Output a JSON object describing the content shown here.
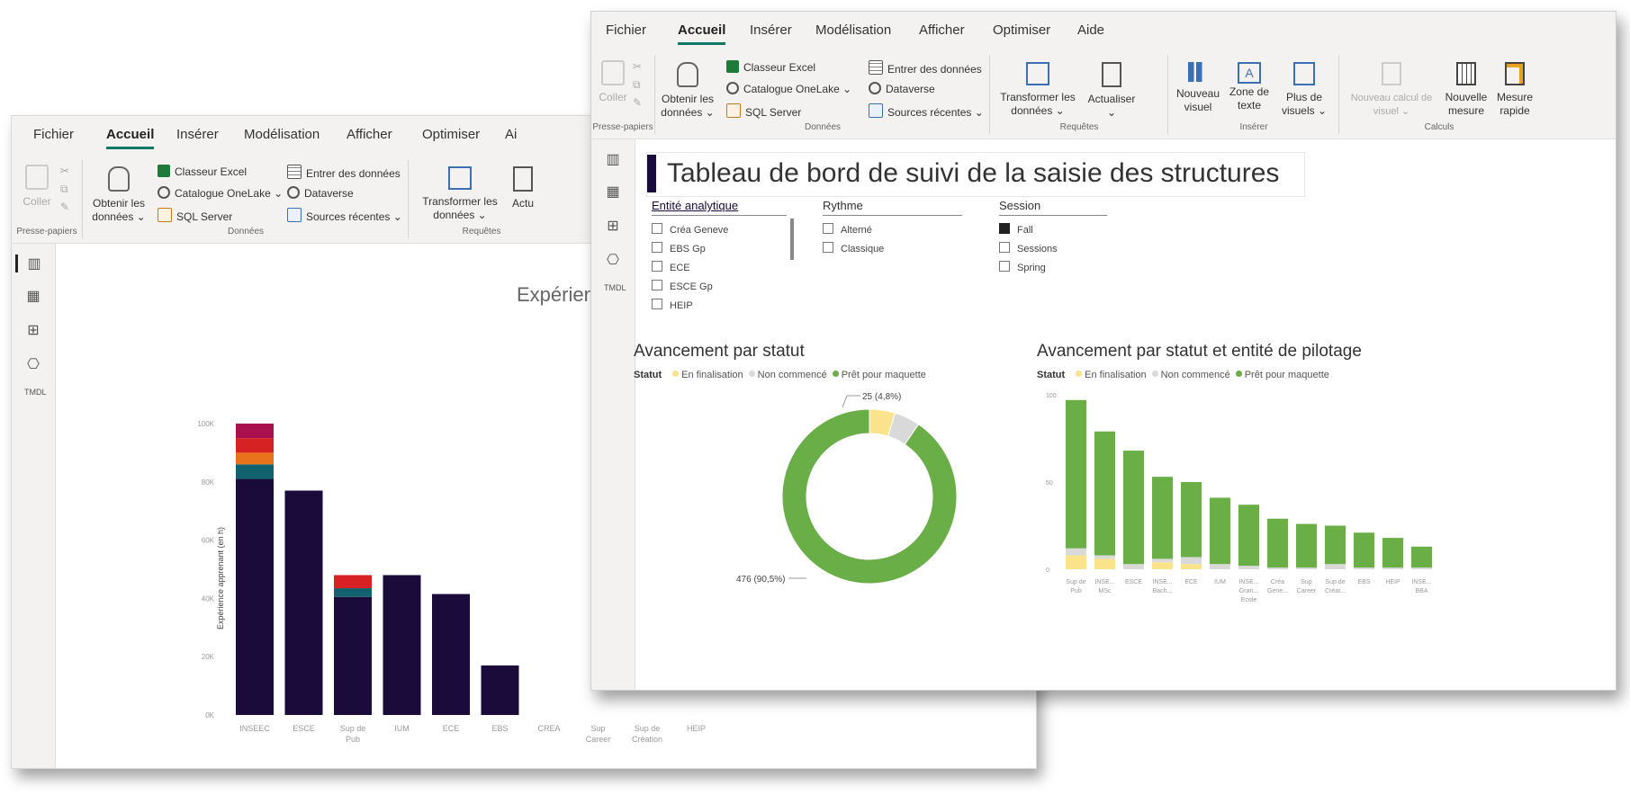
{
  "menu": [
    "Fichier",
    "Accueil",
    "Insérer",
    "Modélisation",
    "Afficher",
    "Optimiser",
    "Aide"
  ],
  "back_menu_last": "Ai",
  "ribbon": {
    "coller": "Coller",
    "presse_papiers": "Presse-papiers",
    "obtenir_l1": "Obtenir les",
    "obtenir_l2": "données ⌄",
    "classeur": "Classeur Excel",
    "onelake": "Catalogue OneLake ⌄",
    "sql": "SQL Server",
    "entrer": "Entrer des données",
    "dataverse": "Dataverse",
    "sources": "Sources récentes ⌄",
    "donnees": "Données",
    "transformer_l1": "Transformer les",
    "transformer_l2": "données ⌄",
    "actualiser": "Actualiser",
    "actualiser_back": "Actu",
    "requetes": "Requêtes",
    "nouveau_l1": "Nouveau",
    "nouveau_l2": "visuel",
    "zone_l1": "Zone de",
    "zone_l2": "texte",
    "plus_l1": "Plus de",
    "plus_l2": "visuels ⌄",
    "inserer": "Insérer",
    "nouveau_calc_l1": "Nouveau calcul de",
    "nouveau_calc_l2": "visuel ⌄",
    "nouvelle_l1": "Nouvelle",
    "nouvelle_l2": "mesure",
    "mesure_l1": "Mesure",
    "mesure_l2": "rapide",
    "calculs": "Calculs"
  },
  "icons": [
    "report-view-icon",
    "table-view-icon",
    "model-view-icon",
    "dax-query-icon",
    "tmdl-view-icon"
  ],
  "tmdl": "TMDL",
  "colors": {
    "accent": "#117865",
    "dark": "#1a0b3a",
    "green": "#6aae47",
    "yellow": "#fbe38c",
    "gray": "#d9d9d9",
    "teal": "#11626e",
    "orange": "#e8731c",
    "red": "#d62222",
    "magenta": "#a8114e"
  },
  "back_chart": {
    "title": "Expérience \"localisée",
    "ylabel": "Expérience apprenant (en h)",
    "yticks": [
      "100K",
      "80K",
      "60K",
      "40K",
      "20K",
      "0K"
    ]
  },
  "title": "Tableau de bord de suivi de la saisie des structures",
  "slicers": [
    {
      "header": "Entité analytique",
      "items": [
        "Créa Geneve",
        "EBS Gp",
        "ECE",
        "ESCE Gp",
        "HEIP"
      ],
      "checked": []
    },
    {
      "header": "Rythme",
      "items": [
        "Alterné",
        "Classique"
      ],
      "checked": []
    },
    {
      "header": "Session",
      "items": [
        "Fall",
        "Sessions",
        "Spring"
      ],
      "checked": [
        0
      ]
    }
  ],
  "donut": {
    "heading": "Avancement par statut",
    "legend_title": "Statut",
    "legend": [
      "En finalisation",
      "Non commencé",
      "Prêt pour maquette"
    ],
    "label_top": "25 (4,8%)",
    "label_bottom": "476 (90,5%)"
  },
  "bar2": {
    "heading": "Avancement par statut et entité de pilotage",
    "legend_title": "Statut",
    "legend": [
      "En finalisation",
      "Non commencé",
      "Prêt pour maquette"
    ],
    "yticks": [
      "100",
      "50",
      "0"
    ]
  },
  "chart_data": [
    {
      "type": "bar",
      "title": "Expérience \"localisée",
      "ylabel": "Expérience apprenant (en h)",
      "ylim": [
        0,
        100000
      ],
      "categories": [
        "INSEEC",
        "ESCE",
        "Sup de Pub",
        "IUM",
        "ECE",
        "EBS",
        "CREA",
        "Sup Career",
        "Sup de Création",
        "HEIP"
      ],
      "category_labels": [
        [
          "INSEEC"
        ],
        [
          "ESCE"
        ],
        [
          "Sup de",
          "Pub"
        ],
        [
          "IUM"
        ],
        [
          "ECE"
        ],
        [
          "EBS"
        ],
        [
          "CREA"
        ],
        [
          "Sup",
          "Career"
        ],
        [
          "Sup de",
          "Création"
        ],
        [
          "HEIP"
        ]
      ],
      "series": [
        {
          "values": [
            81000,
            77000,
            40500,
            48000,
            41500,
            17000,
            0,
            0,
            0,
            0
          ]
        },
        {
          "values": [
            5000,
            0,
            3000,
            0,
            0,
            0,
            0,
            0,
            0,
            0
          ]
        },
        {
          "values": [
            4000,
            0,
            0,
            0,
            0,
            0,
            0,
            0,
            0,
            0
          ]
        },
        {
          "values": [
            5000,
            0,
            4500,
            0,
            0,
            0,
            0,
            0,
            0,
            0
          ]
        },
        {
          "values": [
            5000,
            0,
            0,
            0,
            0,
            0,
            0,
            0,
            0,
            0
          ]
        }
      ]
    },
    {
      "type": "pie",
      "title": "Avancement par statut",
      "labels": [
        "En finalisation",
        "Non commencé",
        "Prêt pour maquette"
      ],
      "values": [
        25,
        25,
        476
      ]
    },
    {
      "type": "bar",
      "title": "Avancement par statut et entité de pilotage",
      "ylim": [
        0,
        100
      ],
      "categories": [
        "Sup de Pub",
        "INSEEC MSc",
        "ESCE",
        "INSEEC Bach",
        "ECE",
        "IUM",
        "INSEEC Gran Ecole",
        "Créa Genève",
        "Sup Career",
        "Sup de Création",
        "EBS",
        "HEIP",
        "INSEEC BBA"
      ],
      "category_labels": [
        [
          "Sup de",
          "Pub"
        ],
        [
          "INSE...",
          "MSc"
        ],
        [
          "ESCE"
        ],
        [
          "INSE...",
          "Bach..."
        ],
        [
          "ECE"
        ],
        [
          "IUM"
        ],
        [
          "INSE...",
          "Gran...",
          "Ecole"
        ],
        [
          "Créa",
          "Gene..."
        ],
        [
          "Sup",
          "Career"
        ],
        [
          "Sup de",
          "Créat..."
        ],
        [
          "EBS"
        ],
        [
          "HEIP"
        ],
        [
          "INSE...",
          "BBA"
        ]
      ],
      "series": [
        {
          "name": "En finalisation",
          "values": [
            8,
            6,
            0,
            4,
            3,
            0,
            0,
            0,
            0,
            0,
            0,
            0,
            0
          ]
        },
        {
          "name": "Non commencé",
          "values": [
            4,
            2,
            3,
            2,
            4,
            3,
            2,
            1,
            1,
            3,
            1,
            1,
            1
          ]
        },
        {
          "name": "Prêt pour maquette",
          "values": [
            85,
            71,
            65,
            47,
            43,
            38,
            35,
            28,
            25,
            22,
            20,
            17,
            12
          ]
        }
      ]
    }
  ]
}
